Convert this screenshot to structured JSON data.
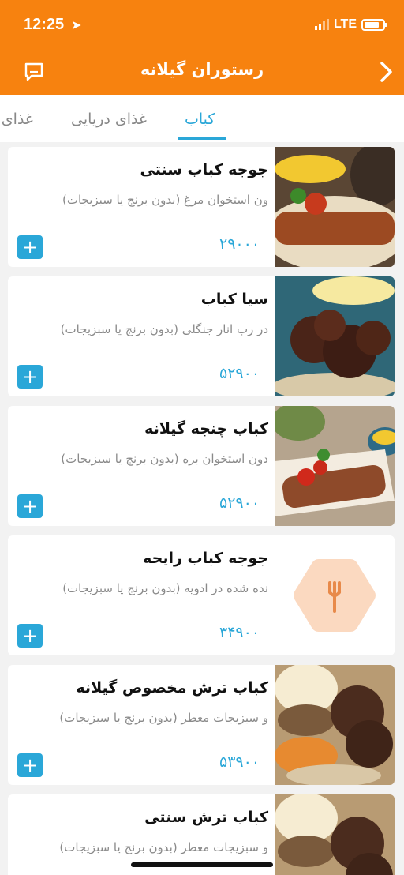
{
  "status": {
    "time": "12:25",
    "network": "LTE"
  },
  "header": {
    "title": "رستوران گیلانه",
    "chat_icon": "chat-icon",
    "back_icon": "chevron-right-icon",
    "color": "#f7820f"
  },
  "tabs": [
    {
      "label": "کباب",
      "active": true
    },
    {
      "label": "غذای دریایی",
      "active": false
    },
    {
      "label": "غذای م",
      "active": false
    }
  ],
  "accent": "#2aa7d8",
  "items": [
    {
      "title": "جوجه کباب سنتی",
      "desc": "ون استخوان مرغ (بدون برنج یا سبزیجات)",
      "price": "۲۹۰۰۰"
    },
    {
      "title": "سیا کباب",
      "desc": "در رب انار جنگلی (بدون برنج یا سبزیجات)",
      "price": "۵۲۹۰۰"
    },
    {
      "title": "کباب چنجه گیلانه",
      "desc": "دون استخوان بره (بدون برنج یا سبزیجات)",
      "price": "۵۲۹۰۰"
    },
    {
      "title": "جوجه کباب رایحه",
      "desc": "نده شده در ادویه (بدون برنج یا سبزیجات)",
      "price": "۳۴۹۰۰"
    },
    {
      "title": "کباب ترش مخصوص گیلانه",
      "desc": "و سبزیجات معطر (بدون برنج یا سبزیجات)",
      "price": "۵۳۹۰۰"
    },
    {
      "title": "کباب ترش سنتی",
      "desc": "و سبزیجات معطر (بدون برنج یا سبزیجات)",
      "price": ""
    }
  ],
  "add_label": "+"
}
